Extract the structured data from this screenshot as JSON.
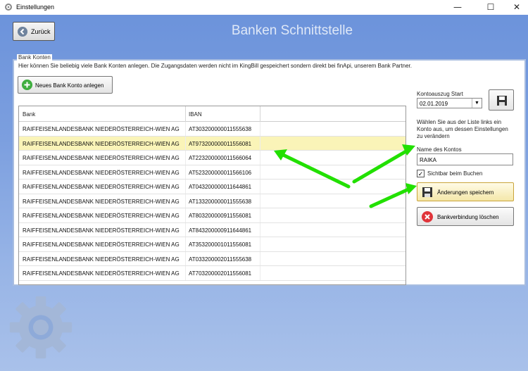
{
  "window": {
    "title": "Einstellungen",
    "minimize_glyph": "—",
    "maximize_glyph": "☐",
    "close_glyph": "✕"
  },
  "toolbar": {
    "back_label": "Zurück",
    "page_title": "Banken Schnittstelle"
  },
  "bank_accounts": {
    "group_title": "Bank Konten",
    "description": "Hier können Sie beliebig viele Bank Konten anlegen. Die Zugangsdaten werden nicht im KingBill gespeichert sondern direkt bei finApi, unserem Bank Partner.",
    "new_button_label": "Neues Bank Konto anlegen",
    "columns": [
      "Bank",
      "IBAN"
    ],
    "rows": [
      {
        "bank": "RAIFFEISENLANDESBANK NIEDERÖSTERREICH-WIEN AG",
        "iban": "AT303200000011555638"
      },
      {
        "bank": "RAIFFEISENLANDESBANK NIEDERÖSTERREICH-WIEN AG",
        "iban": "AT973200000011556081"
      },
      {
        "bank": "RAIFFEISENLANDESBANK NIEDERÖSTERREICH-WIEN AG",
        "iban": "AT223200000011566064"
      },
      {
        "bank": "RAIFFEISENLANDESBANK NIEDERÖSTERREICH-WIEN AG",
        "iban": "AT523200000011566106"
      },
      {
        "bank": "RAIFFEISENLANDESBANK NIEDERÖSTERREICH-WIEN AG",
        "iban": "AT043200000011644861"
      },
      {
        "bank": "RAIFFEISENLANDESBANK NIEDERÖSTERREICH-WIEN AG",
        "iban": "AT133200000011555638"
      },
      {
        "bank": "RAIFFEISENLANDESBANK NIEDERÖSTERREICH-WIEN AG",
        "iban": "AT803200000911556081"
      },
      {
        "bank": "RAIFFEISENLANDESBANK NIEDERÖSTERREICH-WIEN AG",
        "iban": "AT843200000911644861"
      },
      {
        "bank": "RAIFFEISENLANDESBANK NIEDERÖSTERREICH-WIEN AG",
        "iban": "AT353200001011556081"
      },
      {
        "bank": "RAIFFEISENLANDESBANK NIEDERÖSTERREICH-WIEN AG",
        "iban": "AT033200002011555638"
      },
      {
        "bank": "RAIFFEISENLANDESBANK NIEDERÖSTERREICH-WIEN AG",
        "iban": "AT703200002011556081"
      }
    ],
    "selected_row": 1
  },
  "details": {
    "statement_start_label": "Kontoauszug Start",
    "statement_start_value": "02.01.2019",
    "hint": [
      "Wählen Sie aus der Liste links ein",
      "Konto aus, um dessen Einstellungen",
      "zu verändern"
    ],
    "account_name_label": "Name des Kontos",
    "account_name_value": "RAIKA",
    "visible_checkbox_label": "Sichtbar beim Buchen",
    "visible_checked": true,
    "check_glyph": "✓",
    "save_button_label": "Änderungen speichern",
    "delete_button_label": "Bankverbindung löschen"
  },
  "colors": {
    "accent_arrow": "#22e000",
    "selected_row": "#faf4b8",
    "background_top": "#6c93db"
  }
}
